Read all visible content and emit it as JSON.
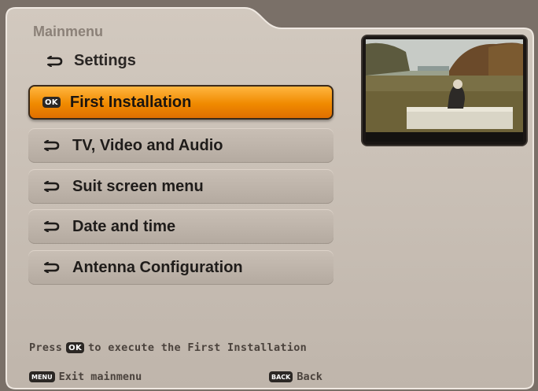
{
  "header": {
    "title": "Mainmenu",
    "subtitle": "Settings"
  },
  "menu": {
    "items": [
      {
        "label": "First Installation",
        "icon": "ok-badge-icon",
        "selected": true
      },
      {
        "label": "TV, Video and Audio",
        "icon": "menu-arrow-icon",
        "selected": false
      },
      {
        "label": "Suit screen menu",
        "icon": "menu-arrow-icon",
        "selected": false
      },
      {
        "label": "Date and time",
        "icon": "menu-arrow-icon",
        "selected": false
      },
      {
        "label": "Antenna Configuration",
        "icon": "menu-arrow-icon",
        "selected": false
      }
    ]
  },
  "badges": {
    "ok": "OK",
    "menu": "MENU",
    "back": "BACK"
  },
  "hint": {
    "prefix": "Press",
    "suffix": "to execute the First Installation"
  },
  "footer": {
    "exit_label": "Exit mainmenu",
    "back_label": "Back"
  },
  "colors": {
    "highlight": "#f08a00",
    "panel": "#c2b8ae",
    "text_dark": "#1f1c1a"
  }
}
